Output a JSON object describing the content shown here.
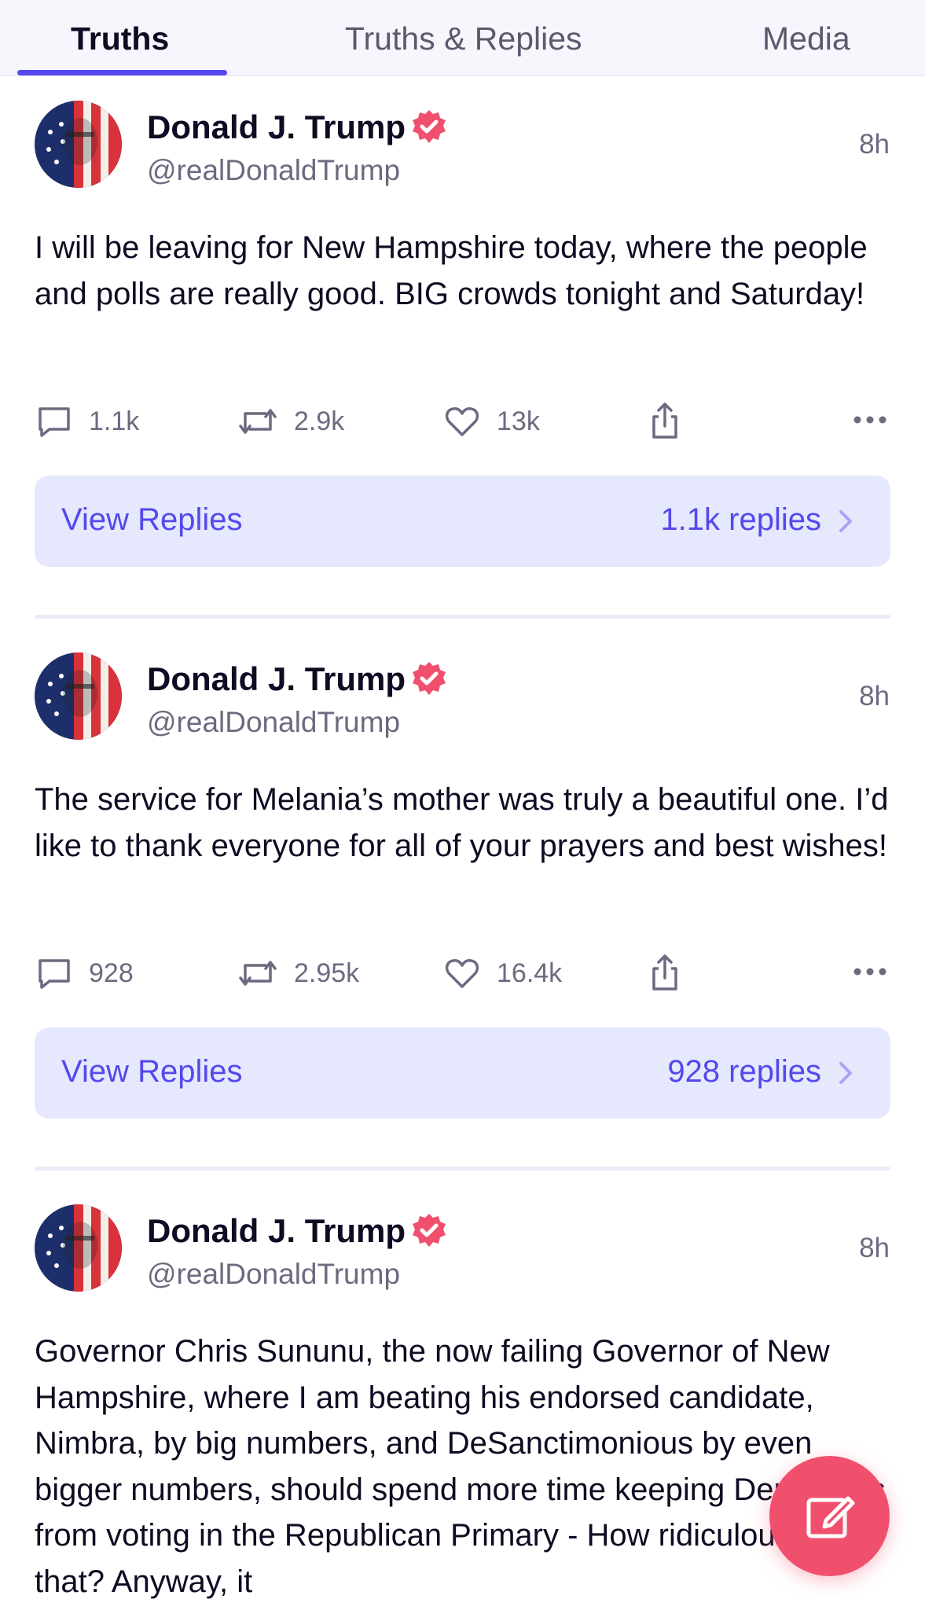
{
  "tabs": [
    {
      "label": "Truths",
      "active": true
    },
    {
      "label": "Truths & Replies",
      "active": false
    },
    {
      "label": "Media",
      "active": false
    }
  ],
  "colors": {
    "accent": "#5448ee",
    "verified": "#f0506e",
    "fab": "#f0506e",
    "replies_bg": "#e6e8fd"
  },
  "posts": [
    {
      "author": "Donald J. Trump",
      "handle": "@realDonaldTrump",
      "time": "8h",
      "text": "I will be leaving for New Hampshire today, where the people and polls are really good. BIG crowds tonight and Saturday!",
      "replies": "1.1k",
      "retruths": "2.9k",
      "likes": "13k",
      "view_replies_label": "View Replies",
      "replies_count_label": "1.1k replies"
    },
    {
      "author": "Donald J. Trump",
      "handle": "@realDonaldTrump",
      "time": "8h",
      "text": "The service for Melania’s mother was truly a beautiful one. I’d like to thank everyone for all of your prayers and best wishes!",
      "replies": "928",
      "retruths": "2.95k",
      "likes": "16.4k",
      "view_replies_label": "View Replies",
      "replies_count_label": "928 replies"
    },
    {
      "author": "Donald J. Trump",
      "handle": "@realDonaldTrump",
      "time": "8h",
      "text": "Governor Chris Sununu, the now failing Governor of New Hampshire, where I am beating his endorsed candidate, Nimbra, by big numbers, and DeSanctimonious by even bigger numbers, should spend more time keeping Democrats from voting in the Republican Primary - How ridiculous is that? Anyway, it"
    }
  ],
  "icons": {
    "verified": "verified-badge-icon",
    "reply": "comment-icon",
    "retruth": "retruth-icon",
    "like": "heart-icon",
    "share": "share-icon",
    "more": "more-dots-icon",
    "chevron": "chevron-right-icon",
    "compose": "compose-icon"
  }
}
